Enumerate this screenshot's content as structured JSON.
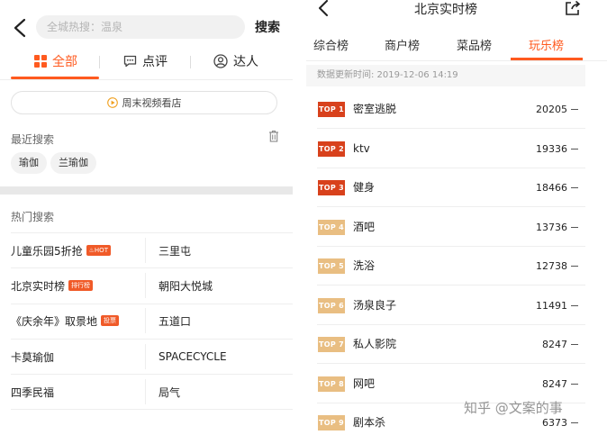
{
  "left": {
    "search_placeholder": "全城热搜：温泉",
    "search_button": "搜索",
    "tabs": [
      {
        "label": "全部",
        "active": true
      },
      {
        "label": "点评",
        "active": false
      },
      {
        "label": "达人",
        "active": false
      }
    ],
    "video_button": "周末视频看店",
    "recent": {
      "title": "最近搜索",
      "chips": [
        "瑜伽",
        "兰瑜伽"
      ]
    },
    "hot": {
      "title": "热门搜索",
      "rows": [
        [
          {
            "text": "儿童乐园5折抢",
            "badge": "HOT",
            "badge_icon": "fire-icon"
          },
          {
            "text": "三里屯",
            "badge": ""
          }
        ],
        [
          {
            "text": "北京实时榜",
            "badge": "排行榜"
          },
          {
            "text": "朝阳大悦城",
            "badge": ""
          }
        ],
        [
          {
            "text": "《庆余年》取景地",
            "badge": "投票"
          },
          {
            "text": "五道口",
            "badge": ""
          }
        ],
        [
          {
            "text": "卡莫瑜伽",
            "badge": ""
          },
          {
            "text": "SPACECYCLE",
            "badge": ""
          }
        ],
        [
          {
            "text": "四季民福",
            "badge": ""
          },
          {
            "text": "局气",
            "badge": ""
          }
        ]
      ]
    },
    "accent": "#ff5a1f"
  },
  "right": {
    "title": "北京实时榜",
    "tabs": [
      {
        "label": "综合榜",
        "active": false
      },
      {
        "label": "商户榜",
        "active": false
      },
      {
        "label": "菜品榜",
        "active": false
      },
      {
        "label": "玩乐榜",
        "active": true
      }
    ],
    "update_time": "数据更新时间: 2019-12-06 14:19",
    "rankings": [
      {
        "rank": "TOP 1",
        "name": "密室逃脱",
        "value": "20205"
      },
      {
        "rank": "TOP 2",
        "name": "ktv",
        "value": "19336"
      },
      {
        "rank": "TOP 3",
        "name": "健身",
        "value": "18466"
      },
      {
        "rank": "TOP 4",
        "name": "酒吧",
        "value": "13736"
      },
      {
        "rank": "TOP 5",
        "name": "洗浴",
        "value": "12738"
      },
      {
        "rank": "TOP 6",
        "name": "汤泉良子",
        "value": "11491"
      },
      {
        "rank": "TOP 7",
        "name": "私人影院",
        "value": "8247"
      },
      {
        "rank": "TOP 8",
        "name": "网吧",
        "value": "8247"
      },
      {
        "rank": "TOP 9",
        "name": "剧本杀",
        "value": "6373"
      }
    ],
    "top_badge_color": "#d8411c",
    "other_badge_color": "#e9be82"
  },
  "watermark": "知乎 @文案的事"
}
